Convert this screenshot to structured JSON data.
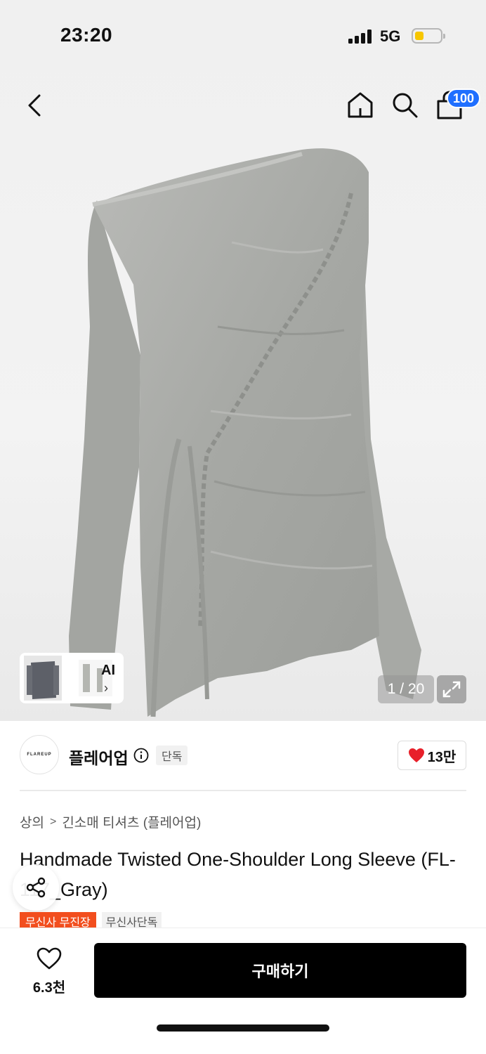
{
  "status_bar": {
    "time": "23:20",
    "network": "5G"
  },
  "nav": {
    "cart_count": "100"
  },
  "gallery": {
    "counter": "1 / 20",
    "ai_label": "AI",
    "ai_arrow": "›"
  },
  "brand": {
    "logo_text": "FLAREUP",
    "name": "플레어업",
    "exclusive_tag": "단독",
    "likes": "13만"
  },
  "breadcrumb": [
    "상의",
    "긴소매 티셔츠 (플레어업)"
  ],
  "product": {
    "title": "Handmade Twisted One-Shoulder Long Sleeve (FL-117_Gray)",
    "tags": [
      "무신사 무진장",
      "무신사단독"
    ]
  },
  "bottom_bar": {
    "wish_count": "6.3천",
    "buy_label": "구매하기"
  },
  "colors": {
    "accent_blue": "#1f6fff",
    "tag_orange": "#f24e1e",
    "heart_red": "#e8202a",
    "battery_yellow": "#f7c600"
  }
}
